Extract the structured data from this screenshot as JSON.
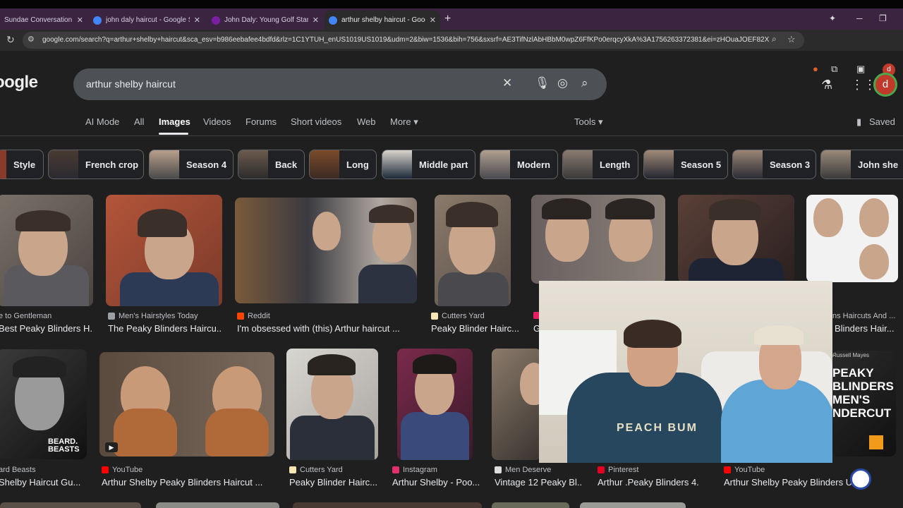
{
  "browser": {
    "tabs": [
      {
        "title": "Sundae Conversation - Yo",
        "favicon_color": "#ff0000"
      },
      {
        "title": "john daly haircut - Google Sear",
        "favicon_color": "#4285f4"
      },
      {
        "title": "John Daly: Young Golf Star to S",
        "favicon_color": "#7b1fa2"
      },
      {
        "title": "arthur shelby haircut - Google",
        "favicon_color": "#4285f4"
      }
    ],
    "url": "google.com/search?q=arthur+shelby+haircut&sca_esv=b986eebafee4bdfd&rlz=1C1YTUH_enUS1019US1019&udm=2&biw=1536&bih=756&sxsrf=AE3TifNzlAbHBbM0wpZ6FfKPo0erqcyXkA%3A1756263372381&ei=zHOuaJOEF82Xwb...",
    "profile_initial": "d"
  },
  "google": {
    "logo": "oogle",
    "query": "arthur shelby haircut",
    "avatar_initial": "d",
    "nav": [
      "AI Mode",
      "All",
      "Images",
      "Videos",
      "Forums",
      "Short videos",
      "Web",
      "More ▾"
    ],
    "tools": "Tools ▾",
    "saved": "Saved"
  },
  "chips": [
    "Style",
    "French crop",
    "Season 4",
    "Back",
    "Long",
    "Middle part",
    "Modern",
    "Length",
    "Season 5",
    "Season 3",
    "John she"
  ],
  "row1": [
    {
      "source": "e to Gentleman",
      "caption": "Best Peaky Blinders H...",
      "fav": "#888888"
    },
    {
      "source": "Men's Hairstyles Today",
      "caption": "The Peaky Blinders Haircu...",
      "fav": "#9aa0a6"
    },
    {
      "source": "Reddit",
      "caption": "I'm obsessed with (this) Arthur haircut ...",
      "fav": "#ff4500"
    },
    {
      "source": "Cutters Yard",
      "caption": "Peaky Blinder Hairc...",
      "fav": "#f5e6b3"
    },
    {
      "source": "",
      "caption": "G",
      "fav": "#e91e63"
    },
    {
      "source": "ns Haircuts And ...",
      "caption": "Blinders Hair...",
      "fav": ""
    }
  ],
  "row2": [
    {
      "source": "ard Beasts",
      "caption": "Shelby Haircut Gu...",
      "fav": ""
    },
    {
      "source": "YouTube",
      "caption": "Arthur Shelby Peaky Blinders Haircut ...",
      "fav": "#ff0000"
    },
    {
      "source": "Cutters Yard",
      "caption": "Peaky Blinder Hairc...",
      "fav": "#f5e6b3"
    },
    {
      "source": "Instagram",
      "caption": "Arthur Shelby - Poo...",
      "fav": "#e1306c"
    },
    {
      "source": "Men Deserve",
      "caption": "Vintage 12 Peaky Bl...",
      "fav": "#dddddd"
    },
    {
      "source": "Pinterest",
      "caption": "Arthur .Peaky Blinders 4.",
      "fav": "#e60023"
    },
    {
      "source": "YouTube",
      "caption": "Arthur Shelby Peaky Blinders Un",
      "fav": "#ff0000"
    }
  ],
  "overlays": {
    "beard_beasts": "BEARD.\nBEASTS",
    "peaky_text": "PEAKY\nBLINDERS\nMEN'S\nNDERCUT",
    "russell": "Russell Mayes",
    "shirt": "PEACH BUM"
  }
}
